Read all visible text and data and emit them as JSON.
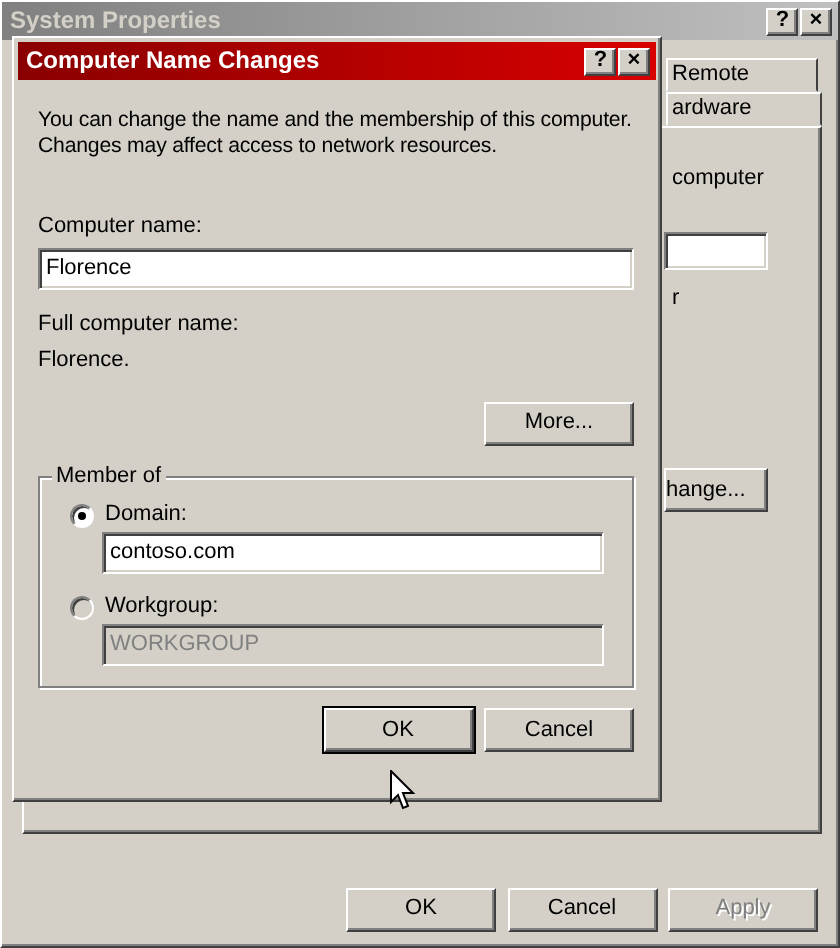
{
  "background_window": {
    "title": "System Properties",
    "active": false,
    "title_buttons": [
      "?",
      "×"
    ],
    "tabs": [
      {
        "label": "Remote",
        "selected": false
      },
      {
        "label": "ardware",
        "selected": false
      }
    ],
    "texts": [
      "computer",
      "r"
    ],
    "change_button": "hange...",
    "buttons": [
      {
        "label": "OK",
        "disabled": false
      },
      {
        "label": "Cancel",
        "disabled": false
      },
      {
        "label": "Apply",
        "disabled": true
      }
    ]
  },
  "dialog": {
    "title": "Computer Name Changes",
    "active": true,
    "title_buttons": [
      "?",
      "×"
    ],
    "description": "You can change the name and the membership of this computer. Changes may affect access to network resources.",
    "computer_name_label": "Computer name:",
    "computer_name": "Florence",
    "full_name_label": "Full computer name:",
    "full_name": "Florence.",
    "more_button": "More...",
    "member_of": {
      "legend": "Member of",
      "options": [
        {
          "label": "Domain:",
          "selected": true,
          "value": "contoso.com",
          "disabled": false
        },
        {
          "label": "Workgroup:",
          "selected": false,
          "value": "WORKGROUP",
          "disabled": true
        }
      ]
    },
    "buttons": [
      {
        "label": "OK",
        "default": true
      },
      {
        "label": "Cancel",
        "default": false
      }
    ]
  }
}
